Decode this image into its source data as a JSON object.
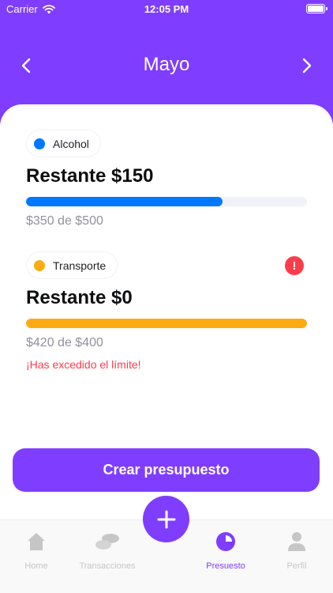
{
  "status_bar": {
    "carrier": "Carrier",
    "time": "12:05 PM"
  },
  "header": {
    "month": "Mayo"
  },
  "budgets": [
    {
      "category": "Alcohol",
      "color": "#0077ff",
      "remaining": "Restante $150",
      "progress": 0.7,
      "amount": "$350 de $500",
      "warning": ""
    },
    {
      "category": "Transporte",
      "color": "#fcac12",
      "remaining": "Restante $0",
      "progress": 1.0,
      "amount": "$420 de $400",
      "warning": "¡Has excedido el límite!",
      "alert_icon": "!"
    }
  ],
  "actions": {
    "create_label": "Crear presupuesto"
  },
  "tabs": [
    {
      "label": "Home",
      "icon": "home-icon"
    },
    {
      "label": "Transacciones",
      "icon": "transactions-icon"
    },
    {
      "label": "Presuesto",
      "icon": "pie-chart-icon"
    },
    {
      "label": "Perfil",
      "icon": "user-icon"
    }
  ],
  "colors": {
    "primary": "#7f3dff",
    "danger": "#fd3c4a",
    "inactive": "#c6c6c6"
  }
}
